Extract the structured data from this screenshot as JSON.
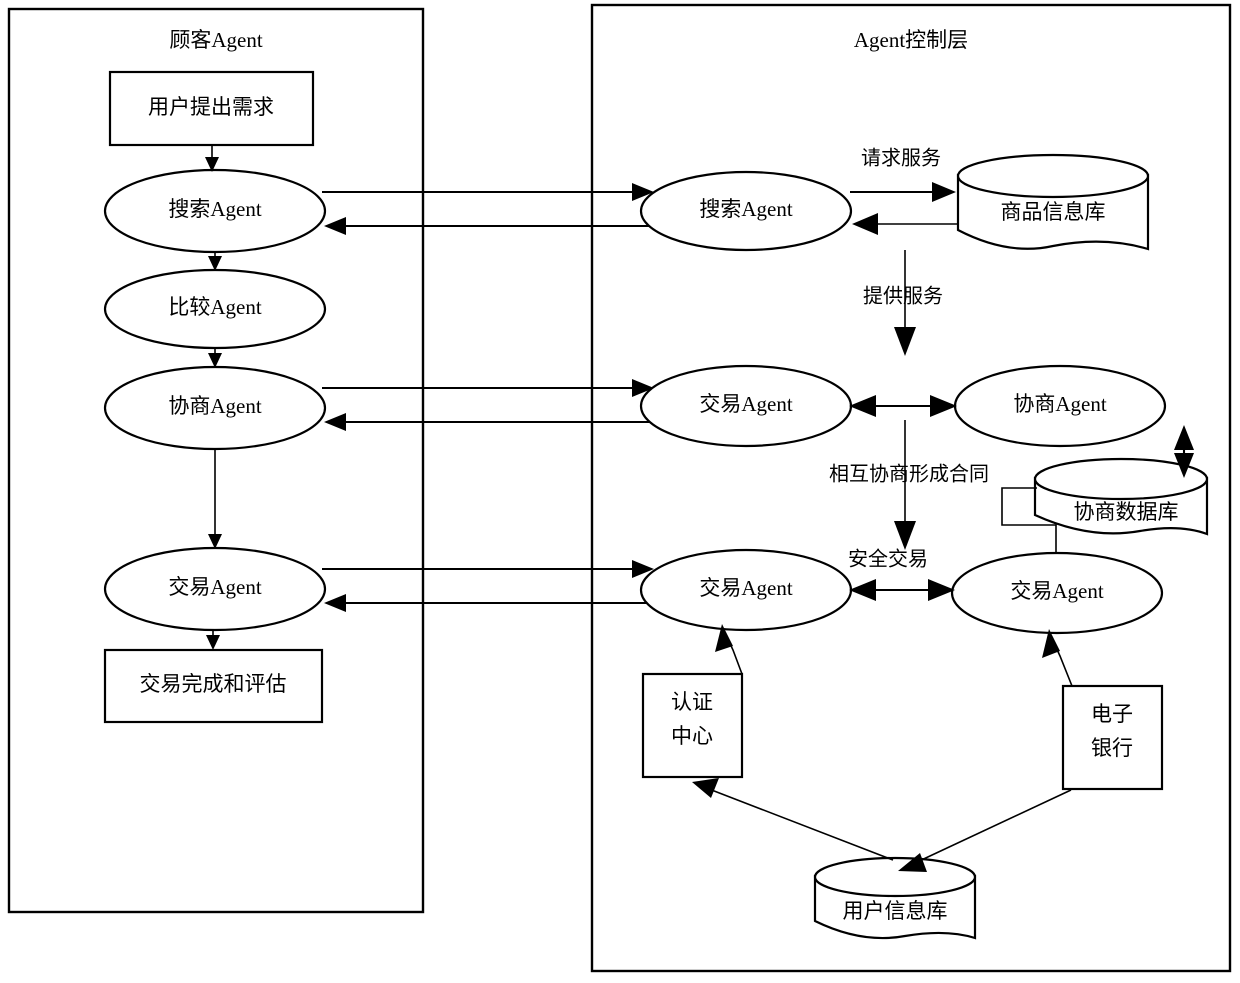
{
  "diagram": {
    "title_hidden": "",
    "panels": [
      {
        "id": "customer",
        "label": "顾客Agent"
      },
      {
        "id": "control",
        "label": "Agent控制层"
      }
    ],
    "customer_nodes": {
      "request_box": "用户提出需求",
      "search_agent": "搜索Agent",
      "compare_agent": "比较Agent",
      "negotiate_agent": "协商Agent",
      "trade_agent": "交易Agent",
      "complete_box": "交易完成和评估"
    },
    "control_nodes": {
      "search_agent": "搜索Agent",
      "product_db": "商品信息库",
      "trade_agent_mid": "交易Agent",
      "negotiate_agent": "协商Agent",
      "negotiate_db": "协商数据库",
      "trade_agent_left": "交易Agent",
      "trade_agent_right": "交易Agent",
      "ca_box_line1": "认证",
      "ca_box_line2": "中心",
      "bank_box_line1": "电子",
      "bank_box_line2": "银行",
      "user_db": "用户信息库"
    },
    "edge_labels": {
      "request_service": "请求服务",
      "provide_service": "提供服务",
      "mutual_contract": "相互协商形成合同",
      "secure_trade": "安全交易"
    },
    "colors": {
      "stroke": "#000000",
      "fill": "#ffffff",
      "background": "#ffffff"
    }
  }
}
